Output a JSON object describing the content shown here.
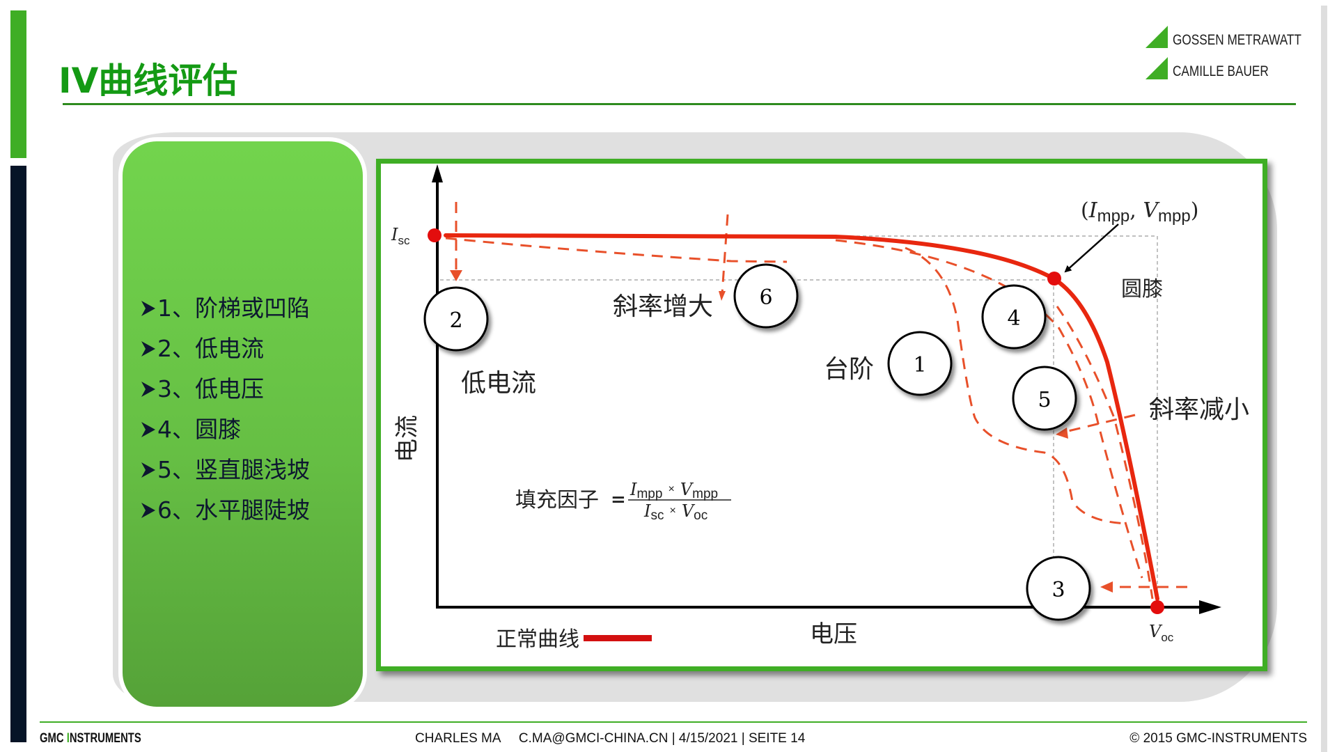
{
  "slide": {
    "title": "IV曲线评估",
    "page_number": 14
  },
  "logo": {
    "line1": "GOSSEN METRAWATT",
    "line2": "CAMILLE BAUER",
    "accent_color": "#3fae25"
  },
  "issues": [
    {
      "num": "1、",
      "label": "阶梯或凹陷"
    },
    {
      "num": "2、",
      "label": "低电流"
    },
    {
      "num": "3、",
      "label": "低电压"
    },
    {
      "num": "4、",
      "label": "圆膝"
    },
    {
      "num": "5、",
      "label": "竖直腿浅坡"
    },
    {
      "num": "6、",
      "label": "水平腿陡坡"
    }
  ],
  "diagram": {
    "axis_y_label": "电流",
    "axis_x_label": "电压",
    "isc_label": "I",
    "isc_sub": "sc",
    "voc_label": "V",
    "voc_sub": "oc",
    "mpp_label": {
      "open": "(",
      "i": "I",
      "i_sub": "mpp",
      "sep": ", ",
      "v": "V",
      "v_sub": "mpp",
      "close": ")"
    },
    "annotations": {
      "low_current": "低电流",
      "slope_up": "斜率增大",
      "step": "台阶",
      "round_knee": "圆膝",
      "slope_down": "斜率减小"
    },
    "markers": [
      {
        "id": "1",
        "meaning": "台阶"
      },
      {
        "id": "2",
        "meaning": "低电流"
      },
      {
        "id": "3",
        "meaning": "低电压"
      },
      {
        "id": "4",
        "meaning": "圆膝"
      },
      {
        "id": "5",
        "meaning": "斜率减小"
      },
      {
        "id": "6",
        "meaning": "斜率增大"
      }
    ],
    "fill_factor": {
      "label": "填充因子",
      "eq": "=",
      "num_i": "I",
      "num_i_sub": "mpp",
      "times": "×",
      "num_v": "V",
      "num_v_sub": "mpp",
      "den_i": "I",
      "den_i_sub": "sc",
      "den_v": "V",
      "den_v_sub": "oc"
    },
    "legend": {
      "label": "正常曲线"
    },
    "colors": {
      "normal_curve": "#e8270f",
      "deviation_dash": "#e8502a",
      "axes": "#000000"
    }
  },
  "footer": {
    "brand_a": "GMC ",
    "brand_b": "I",
    "brand_c": "NSTRUMENTS",
    "meta": "CHARLES MA     C.MA@GMCI-CHINA.CN | 4/15/2021 | SEITE 14",
    "copyright": "© 2015 GMC-INSTRUMENTS"
  }
}
